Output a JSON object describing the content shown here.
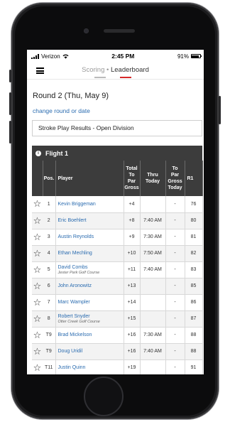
{
  "status": {
    "carrier": "Verizon",
    "time": "2:45 PM",
    "battery_pct": "91%",
    "battery_level": 0.91
  },
  "nav": {
    "tab_scoring": "Scoring",
    "separator": "•",
    "tab_leaderboard": "Leaderboard",
    "accent_red": "#d62828",
    "accent_gray": "#bbbbbb"
  },
  "page": {
    "round_title": "Round 2 (Thu, May 9)",
    "change_link": "change round or date",
    "division": "Stroke Play Results - Open Division"
  },
  "table": {
    "flight": "Flight 1",
    "headers": {
      "pos": "Pos.",
      "player": "Player",
      "total_lines": [
        "Total",
        "To",
        "Par",
        "Gross"
      ],
      "thru_lines": [
        "Thru",
        "Today"
      ],
      "today_lines": [
        "To",
        "Par",
        "Gross",
        "Today"
      ],
      "r1": "R1"
    },
    "rows": [
      {
        "pos": "1",
        "player": "Kevin Briggeman",
        "course": "",
        "total": "+4",
        "thru": "",
        "today": "-",
        "r1": "76"
      },
      {
        "pos": "2",
        "player": "Eric Boehlert",
        "course": "",
        "total": "+8",
        "thru": "7:40 AM",
        "today": "-",
        "r1": "80"
      },
      {
        "pos": "3",
        "player": "Austin Reynolds",
        "course": "",
        "total": "+9",
        "thru": "7:30 AM",
        "today": "-",
        "r1": "81"
      },
      {
        "pos": "4",
        "player": "Ethan Mechling",
        "course": "",
        "total": "+10",
        "thru": "7:50 AM",
        "today": "-",
        "r1": "82"
      },
      {
        "pos": "5",
        "player": "David Combs",
        "course": "Jester Park Golf Course",
        "total": "+11",
        "thru": "7:40 AM",
        "today": "-",
        "r1": "83"
      },
      {
        "pos": "6",
        "player": "John Aronowitz",
        "course": "",
        "total": "+13",
        "thru": "",
        "today": "-",
        "r1": "85"
      },
      {
        "pos": "7",
        "player": "Marc Wampler",
        "course": "",
        "total": "+14",
        "thru": "",
        "today": "-",
        "r1": "86"
      },
      {
        "pos": "8",
        "player": "Robert Snyder",
        "course": "Otter Creek Golf Course",
        "total": "+15",
        "thru": "",
        "today": "-",
        "r1": "87"
      },
      {
        "pos": "T9",
        "player": "Brad Mickelson",
        "course": "",
        "total": "+16",
        "thru": "7:30 AM",
        "today": "-",
        "r1": "88"
      },
      {
        "pos": "T9",
        "player": "Doug Uridil",
        "course": "",
        "total": "+16",
        "thru": "7:40 AM",
        "today": "-",
        "r1": "88"
      },
      {
        "pos": "T11",
        "player": "Justin Quinn",
        "course": "",
        "total": "+19",
        "thru": "",
        "today": "-",
        "r1": "91"
      }
    ]
  }
}
